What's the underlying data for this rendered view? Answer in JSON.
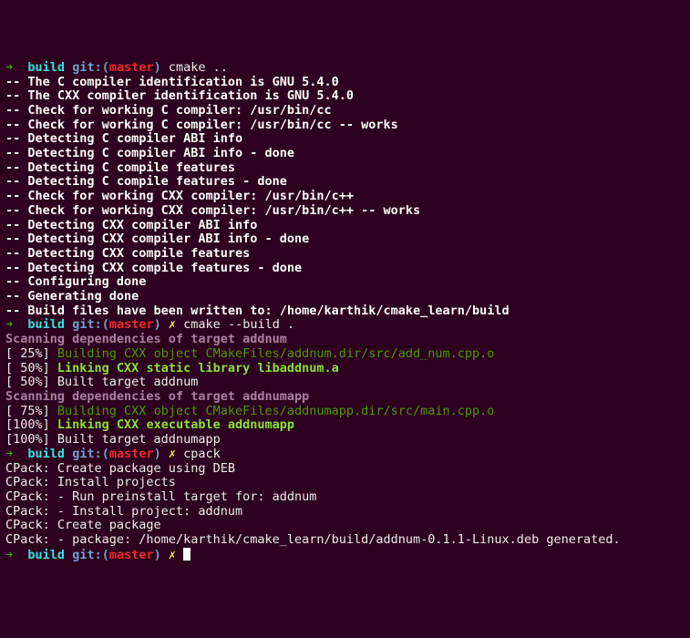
{
  "prompt": {
    "arrow": "➜",
    "dir": "build",
    "git_label": "git:(",
    "branch": "master",
    "git_close": ")",
    "dirty": "✗"
  },
  "cmd1": "cmake ..",
  "cmake_out": [
    "-- The C compiler identification is GNU 5.4.0",
    "-- The CXX compiler identification is GNU 5.4.0",
    "-- Check for working C compiler: /usr/bin/cc",
    "-- Check for working C compiler: /usr/bin/cc -- works",
    "-- Detecting C compiler ABI info",
    "-- Detecting C compiler ABI info - done",
    "-- Detecting C compile features",
    "-- Detecting C compile features - done",
    "-- Check for working CXX compiler: /usr/bin/c++",
    "-- Check for working CXX compiler: /usr/bin/c++ -- works",
    "-- Detecting CXX compiler ABI info",
    "-- Detecting CXX compiler ABI info - done",
    "-- Detecting CXX compile features",
    "-- Detecting CXX compile features - done",
    "-- Configuring done",
    "-- Generating done",
    "-- Build files have been written to: /home/karthik/cmake_learn/build"
  ],
  "cmd2": "cmake --build .",
  "build": {
    "scan1": "Scanning dependencies of target addnum",
    "p25a": "[ 25%] ",
    "p25b": "Building CXX object CMakeFiles/addnum.dir/src/add_num.cpp.o",
    "p50a": "[ 50%] ",
    "p50b": "Linking CXX static library libaddnum.a",
    "p50c": "[ 50%] Built target addnum",
    "scan2": "Scanning dependencies of target addnumapp",
    "p75a": "[ 75%] ",
    "p75b": "Building CXX object CMakeFiles/addnumapp.dir/src/main.cpp.o",
    "p100a": "[100%] ",
    "p100b": "Linking CXX executable addnumapp",
    "p100c": "[100%] Built target addnumapp"
  },
  "cmd3": "cpack",
  "cpack_out": [
    "CPack: Create package using DEB",
    "CPack: Install projects",
    "CPack: - Run preinstall target for: addnum",
    "CPack: - Install project: addnum",
    "CPack: Create package",
    "CPack: - package: /home/karthik/cmake_learn/build/addnum-0.1.1-Linux.deb generated."
  ]
}
